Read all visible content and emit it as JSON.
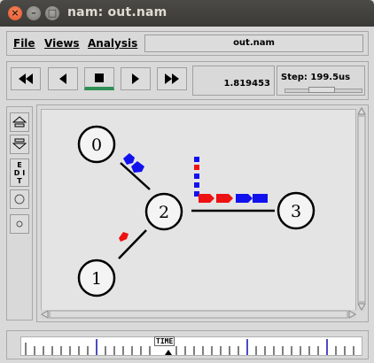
{
  "window": {
    "title": "nam: out.nam",
    "close_glyph": "×",
    "min_glyph": "–",
    "max_glyph": "□"
  },
  "menubar": {
    "file": "File",
    "views": "Views",
    "analysis": "Analysis",
    "filename": "out.nam"
  },
  "controls": {
    "buttons": [
      "rewind-icon",
      "back-icon",
      "stop-icon",
      "play-icon",
      "fast-forward-icon"
    ],
    "current_time": "1.819453",
    "step_label": "Step: 199.5us"
  },
  "tools": {
    "edit_label": "E D I T"
  },
  "topology": {
    "nodes": [
      {
        "id": "0",
        "label": "0"
      },
      {
        "id": "1",
        "label": "1"
      },
      {
        "id": "2",
        "label": "2"
      },
      {
        "id": "3",
        "label": "3"
      }
    ],
    "links": [
      [
        "0",
        "2"
      ],
      [
        "1",
        "2"
      ],
      [
        "2",
        "3"
      ]
    ],
    "packet_colors": {
      "red": "#ee1111",
      "blue": "#1111ee"
    }
  },
  "timeline": {
    "label": "TIME"
  }
}
